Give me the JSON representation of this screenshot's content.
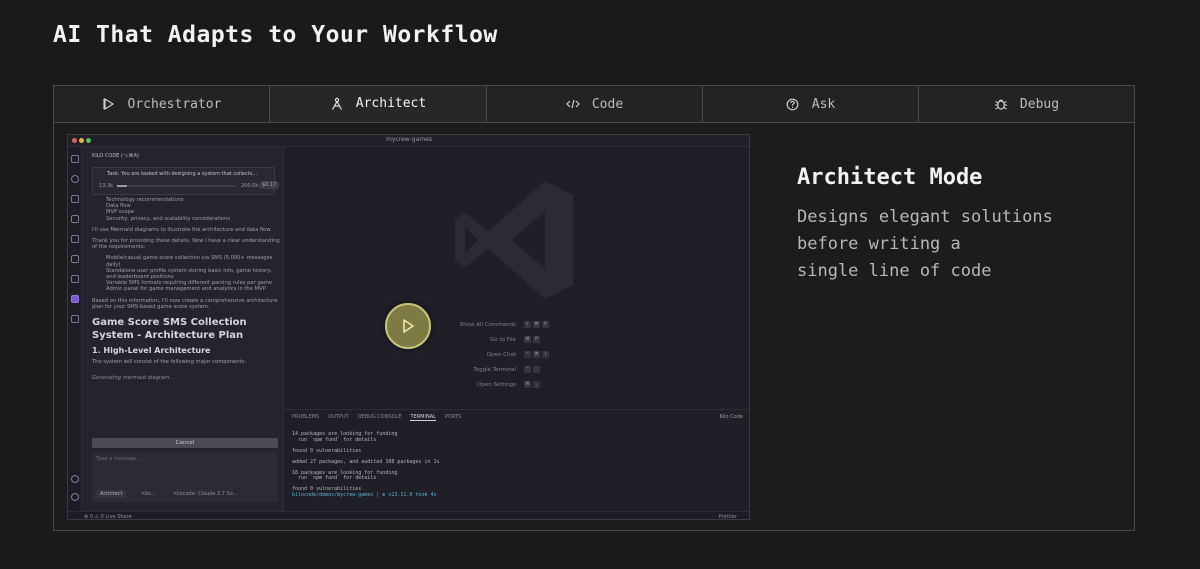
{
  "header": {
    "title": "AI That Adapts to Your Workflow"
  },
  "tabs": [
    {
      "label": "Orchestrator",
      "icon": "play-triangle-icon",
      "active": false
    },
    {
      "label": "Architect",
      "icon": "compass-icon",
      "active": true
    },
    {
      "label": "Code",
      "icon": "code-brackets-icon",
      "active": false
    },
    {
      "label": "Ask",
      "icon": "question-circle-icon",
      "active": false
    },
    {
      "label": "Debug",
      "icon": "bug-icon",
      "active": false
    }
  ],
  "mode": {
    "title": "Architect Mode",
    "description_lines": [
      "Designs elegant solutions",
      "before writing a",
      "single line of code"
    ]
  },
  "video": {
    "play_icon": "play-icon",
    "accent": "#c9c37a",
    "window_title": "mycrew-games",
    "panel_title": "KILO CODE (⌥⌘A)",
    "task": {
      "text": "Task: You are tasked with designing a system that collects...",
      "tokens_in": "13.3k",
      "tokens_max": "200.0k",
      "cost": "$0.17"
    },
    "chat": {
      "req_items": [
        "Technology recommendations",
        "Data flow",
        "MVP scope",
        "Security, privacy, and scalability considerations"
      ],
      "p1": "I'll use Mermaid diagrams to illustrate the architecture and data flow.",
      "p2": "Thank you for providing these details. Now I have a clear understanding of the requirements:",
      "understanding_items": [
        "Mobile/casual game score collection via SMS (5,000+ messages daily)",
        "Standalone user profile system storing basic info, game history, and leaderboard positions",
        "Variable SMS formats requiring different parsing rules per game",
        "Admin panel for game management and analytics in the MVP"
      ],
      "p3": "Based on this information, I'll now create a comprehensive architecture plan for your SMS-based game score system.",
      "heading": "Game Score SMS Collection System - Architecture Plan",
      "subheading": "1. High-Level Architecture",
      "p4": "The system will consist of the following major components:",
      "status": "Generating mermaid diagram..."
    },
    "cancel_label": "Cancel",
    "message_placeholder": "Type a message...",
    "mode_chip": "Architect",
    "model_chip": "kilocode: Claude 3.7 So...",
    "chip2": "kilo...",
    "shortcuts": [
      {
        "label": "Show All Commands",
        "keys": [
          "⇧",
          "⌘",
          "P"
        ]
      },
      {
        "label": "Go to File",
        "keys": [
          "⌘",
          "P"
        ]
      },
      {
        "label": "Open Chat",
        "keys": [
          "^",
          "⌘",
          "I"
        ]
      },
      {
        "label": "Toggle Terminal",
        "keys": [
          "^",
          "`"
        ]
      },
      {
        "label": "Open Settings",
        "keys": [
          "⌘",
          ","
        ]
      }
    ],
    "terminal_tabs": [
      "PROBLEMS",
      "OUTPUT",
      "DEBUG CONSOLE",
      "TERMINAL",
      "PORTS"
    ],
    "terminal_right": "Kilo Code",
    "terminal_lines": [
      "14 packages are looking for funding",
      "  run `npm fund` for details",
      "",
      "found 0 vulnerabilities",
      "",
      "added 27 packages, and audited 108 packages in 1s",
      "",
      "18 packages are looking for funding",
      "  run `npm fund` for details",
      "",
      "found 0 vulnerabilities"
    ],
    "terminal_prompt": "kilocode/demos/mycrew-games | ⊕ v23.11.0 took 4s",
    "status_left": "⊗ 0 ⚠ 0   Live Share",
    "status_right": "Prettier"
  }
}
